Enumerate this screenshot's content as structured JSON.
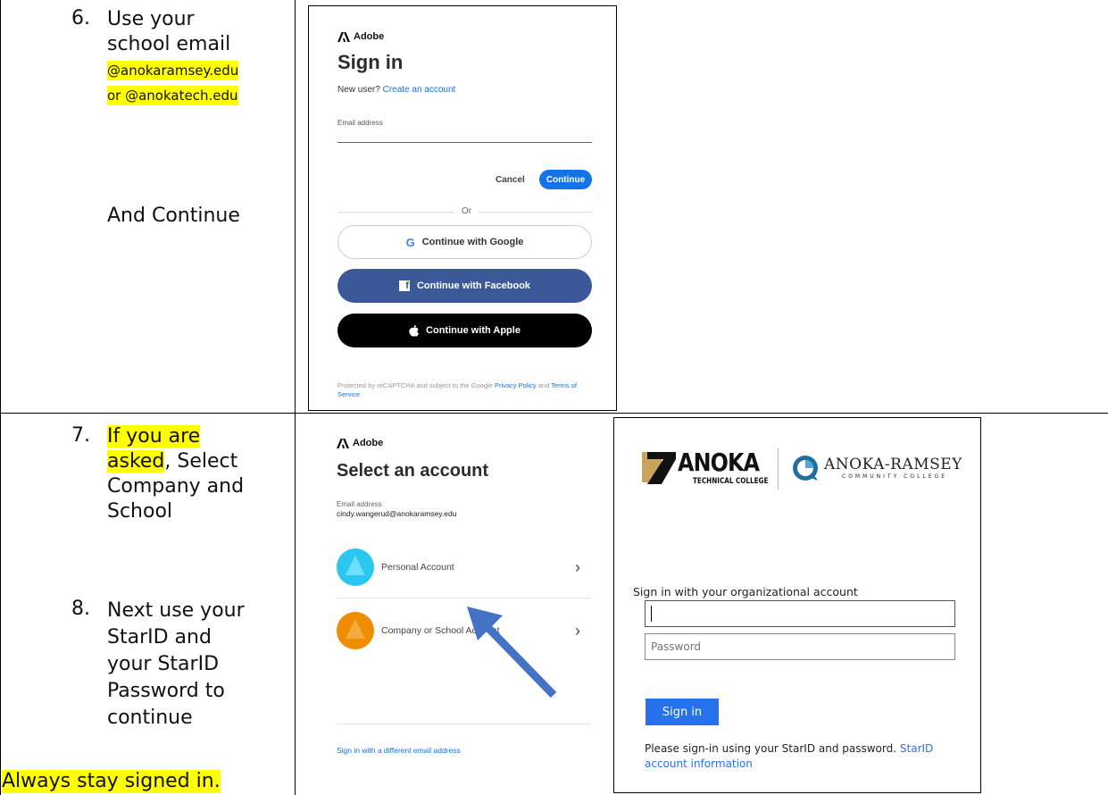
{
  "row1": {
    "step_number": "6.",
    "step_lines": [
      "Use your",
      "school email"
    ],
    "email_domains": [
      "@anokaramsey.edu",
      "or @anokatech.edu"
    ],
    "and_continue": "And Continue"
  },
  "adobe_signin": {
    "brand": "Adobe",
    "title": "Sign in",
    "new_user": "New user?",
    "create_account": "Create an account",
    "email_label": "Email address",
    "email_value": "",
    "cancel": "Cancel",
    "continue": "Continue",
    "or": "Or",
    "google": "Continue with Google",
    "facebook": "Continue with Facebook",
    "apple": "Continue with Apple",
    "recaptcha_pre": "Protected by reCAPTCHA and subject to the Google",
    "privacy_policy": "Privacy Policy",
    "and": "and",
    "terms": "Terms of Service",
    "colors": {
      "accent": "#1473e6",
      "facebook": "#3b5998",
      "apple": "#000000"
    }
  },
  "row2": {
    "step7_number": "7.",
    "step7_lines": [
      "If you are",
      "asked",
      ",  Select",
      "Company and",
      "School"
    ],
    "step8_number": "8.",
    "step8_lines": [
      "Next use your",
      "StarID and",
      "your StarID",
      "Password to",
      "continue"
    ],
    "stay_signed_in": "Always stay signed in."
  },
  "adobe_select": {
    "brand": "Adobe",
    "title": "Select an account",
    "email_label": "Email address",
    "email_value": "cindy.wangerud@anokaramsey.edu",
    "personal": "Personal Account",
    "company": "Company or School Account",
    "different_email": "Sign in with a different email address"
  },
  "org_signin": {
    "logo_anoka": "ANOKA",
    "logo_anoka_sub": "TECHNICAL COLLEGE",
    "logo_ramsey": "ANOKA-RAMSEY",
    "logo_ramsey_sub": "COMMUNITY COLLEGE",
    "heading": "Sign in with your organizational account",
    "username_value": "",
    "password_placeholder": "Password",
    "sign_in": "Sign in",
    "help_text": "Please sign-in using your StarID and password.",
    "help_link": "StarID account information"
  }
}
